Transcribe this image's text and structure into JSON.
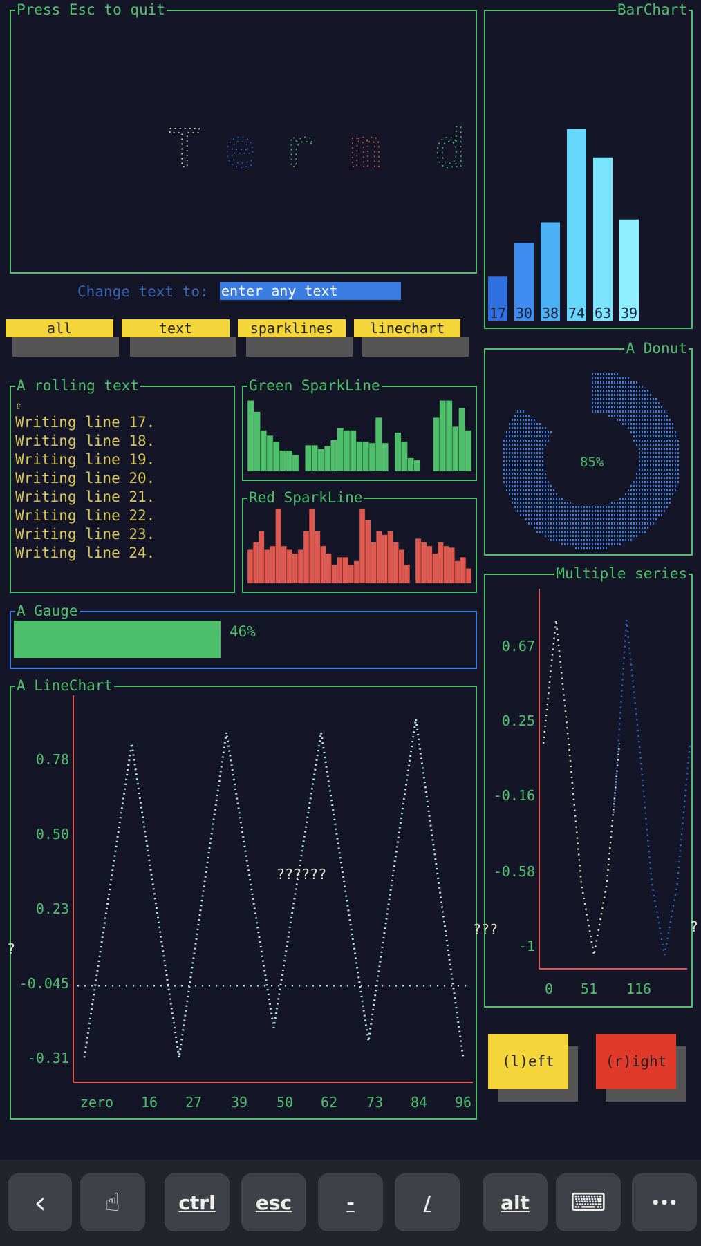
{
  "header_panel": {
    "title": "Press Esc to quit",
    "big_text": "Termd",
    "prompt_label": "Change text to:",
    "input_placeholder": "enter any text"
  },
  "tabs": [
    "all",
    "text",
    "sparklines",
    "linechart"
  ],
  "rolling": {
    "title": "A rolling text",
    "arrow": "⇧",
    "lines": [
      "Writing line 17.",
      "Writing line 18.",
      "Writing line 19.",
      "Writing line 20.",
      "Writing line 21.",
      "Writing line 22.",
      "Writing line 23.",
      "Writing line 24."
    ]
  },
  "green_spark": {
    "title": "Green SparkLine",
    "color": "#4ec06c",
    "values": [
      95,
      80,
      55,
      48,
      40,
      28,
      28,
      22,
      0,
      35,
      35,
      30,
      34,
      42,
      58,
      55,
      55,
      40,
      40,
      38,
      72,
      38,
      0,
      52,
      40,
      18,
      15,
      0,
      0,
      72,
      95,
      95,
      60,
      85,
      55
    ]
  },
  "red_spark": {
    "title": "Red SparkLine",
    "color": "#e0584f",
    "values": [
      45,
      55,
      70,
      45,
      50,
      100,
      50,
      45,
      40,
      45,
      70,
      100,
      70,
      50,
      40,
      25,
      35,
      35,
      25,
      30,
      100,
      85,
      55,
      70,
      65,
      70,
      55,
      45,
      25,
      0,
      60,
      55,
      50,
      40,
      55,
      50,
      48,
      30,
      35,
      20
    ]
  },
  "gauge": {
    "title": "A Gauge",
    "percent": 46,
    "label": "46%",
    "color": "#4ec06c"
  },
  "barchart": {
    "title": "BarChart",
    "chart_data": {
      "type": "bar",
      "categories": [
        "",
        "",
        "",
        "",
        "",
        ""
      ],
      "values": [
        17,
        30,
        38,
        74,
        63,
        39
      ],
      "colors": [
        "#2f6fe0",
        "#3f8cf0",
        "#4cb0f4",
        "#67d6fc",
        "#7ae4fd",
        "#8defff"
      ]
    }
  },
  "donut": {
    "title": "A Donut",
    "label": "85%",
    "percent": 85,
    "color": "#3a7ce0"
  },
  "multi_series": {
    "title": "Multiple series",
    "y_ticks": [
      "0.67",
      "0.25",
      "-0.16",
      "-0.58",
      "-1"
    ],
    "x_ticks": [
      "0",
      "51",
      "116"
    ],
    "overflow_mark": "?",
    "chart_data": {
      "type": "line",
      "ylim": [
        -1,
        1
      ],
      "series": [
        {
          "values": [
            0.25,
            0.98,
            0.25,
            -0.58,
            -1,
            -0.58,
            0.25
          ]
        },
        {
          "values": [
            -0.16,
            0.98,
            0.25,
            -0.58,
            -1,
            -0.58,
            0.25
          ]
        }
      ]
    }
  },
  "linechart": {
    "title": "A LineChart",
    "y_ticks": [
      "0.78",
      "0.50",
      "0.23",
      "-0.045",
      "-0.31"
    ],
    "x_ticks": [
      "zero",
      "16",
      "27",
      "39",
      "50",
      "62",
      "73",
      "84",
      "96"
    ],
    "overflow_left": "?",
    "overflow_right": "???",
    "annotation": "??????",
    "chart_data": {
      "type": "line",
      "ylim": [
        -0.35,
        0.9
      ],
      "x": [
        "zero",
        "16",
        "27",
        "39",
        "50",
        "62",
        "73",
        "84",
        "96"
      ],
      "series": [
        {
          "values": [
            -0.31,
            0.85,
            -0.31,
            0.89,
            -0.2,
            0.89,
            -0.25,
            0.94,
            -0.31
          ]
        }
      ]
    }
  },
  "buttons": {
    "left": "(l)eft",
    "right": "(r)ight",
    "left_color": "#f4d53a",
    "right_color": "#e23a2a"
  },
  "keyboard": {
    "keys": [
      "‹",
      "☝",
      "ctrl",
      "esc",
      "-",
      "/",
      "alt",
      "⌨",
      "•••"
    ]
  }
}
